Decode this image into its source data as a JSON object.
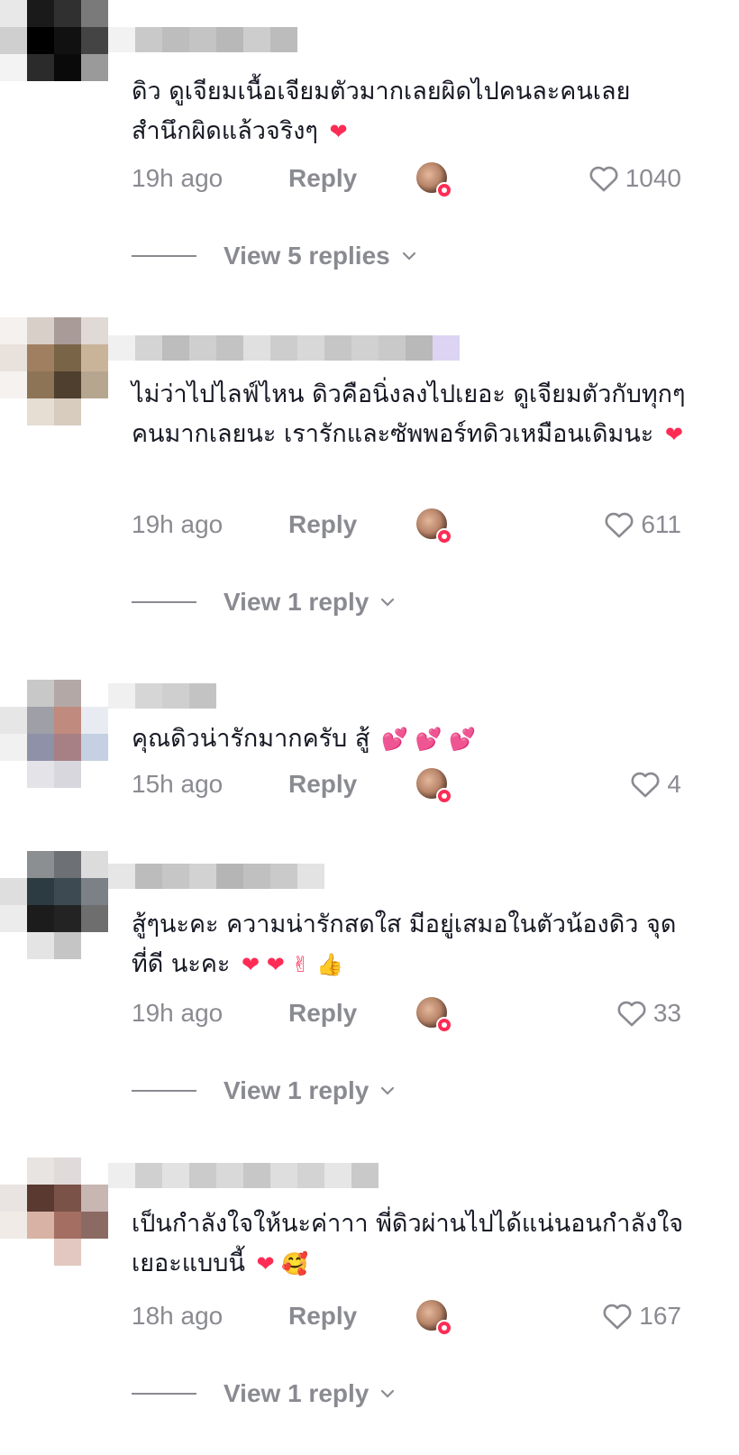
{
  "comments": [
    {
      "text": "ดิว ดูเจียมเนื้อเจียมตัวมากเลยผิดไปคนละคนเลย สำนึกผิดแล้วจริงๆ",
      "emoji": "❤",
      "time": "19h ago",
      "reply": "Reply",
      "likes": "1040",
      "view_replies": "View 5 replies"
    },
    {
      "text": "ไม่ว่าไปไลฟ์ไหน ดิวคือนิ่งลงไปเยอะ ดูเจียมตัวกับทุกๆคนมากเลยนะ เรารักและซัพพอร์ทดิวเหมือนเดิมนะ",
      "emoji": "❤",
      "time": "19h ago",
      "reply": "Reply",
      "likes": "611",
      "view_replies": "View 1 reply"
    },
    {
      "text": "คุณดิวน่ารักมากครับ สู้",
      "emoji": "💕 💕 💕",
      "time": "15h ago",
      "reply": "Reply",
      "likes": "4",
      "view_replies": ""
    },
    {
      "text": "สู้ๆนะคะ ความน่ารักสดใส มีอยู่เสมอในตัวน้องดิว จุดที่ดี นะคะ",
      "emoji": "❤ ❤ ✌ 👍",
      "time": "19h ago",
      "reply": "Reply",
      "likes": "33",
      "view_replies": "View 1 reply"
    },
    {
      "text": "เป็นกำลังใจให้นะค่าาา พี่ดิวผ่านไปได้แน่นอนกำลังใจเยอะแบบนี้",
      "emoji": "❤ 🥰",
      "time": "18h ago",
      "reply": "Reply",
      "likes": "167",
      "view_replies": "View 1 reply"
    }
  ],
  "icons": {
    "like": "heart-outline-icon",
    "expand": "chevron-down-icon",
    "creator_badge": "creator-liked-avatar"
  },
  "colors": {
    "muted": "#8a8b91",
    "text": "#161823",
    "accent": "#fe2c55"
  }
}
